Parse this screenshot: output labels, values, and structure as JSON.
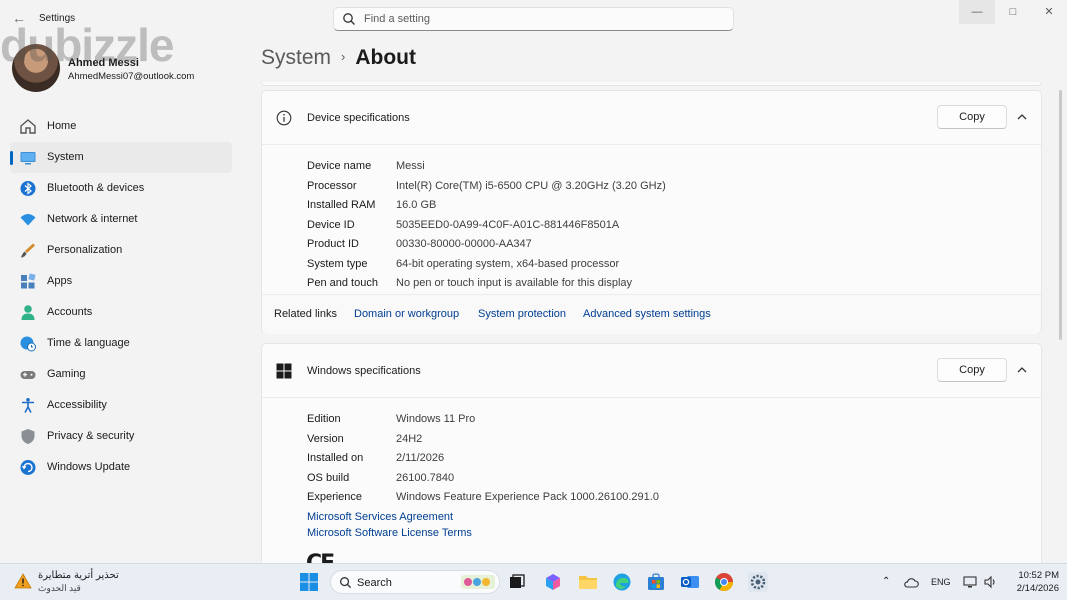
{
  "app": {
    "title": "Settings",
    "search_placeholder": "Find a setting",
    "watermark": "dubizzle"
  },
  "profile": {
    "name": "Ahmed Messi",
    "email": "AhmedMessi07@outlook.com"
  },
  "sidebar": {
    "items": [
      {
        "label": "Home",
        "icon": "home-icon"
      },
      {
        "label": "System",
        "icon": "system-icon",
        "active": true
      },
      {
        "label": "Bluetooth & devices",
        "icon": "bluetooth-icon"
      },
      {
        "label": "Network & internet",
        "icon": "network-icon"
      },
      {
        "label": "Personalization",
        "icon": "brush-icon"
      },
      {
        "label": "Apps",
        "icon": "apps-icon"
      },
      {
        "label": "Accounts",
        "icon": "accounts-icon"
      },
      {
        "label": "Time & language",
        "icon": "globe-clock-icon"
      },
      {
        "label": "Gaming",
        "icon": "gamepad-icon"
      },
      {
        "label": "Accessibility",
        "icon": "accessibility-icon"
      },
      {
        "label": "Privacy & security",
        "icon": "shield-icon"
      },
      {
        "label": "Windows Update",
        "icon": "update-icon"
      }
    ]
  },
  "breadcrumb": {
    "parent": "System",
    "separator": "›",
    "current": "About"
  },
  "device_specs": {
    "title": "Device specifications",
    "copy_label": "Copy",
    "rows": [
      {
        "label": "Device name",
        "value": "Messi"
      },
      {
        "label": "Processor",
        "value": "Intel(R) Core(TM) i5-6500 CPU @ 3.20GHz (3.20 GHz)"
      },
      {
        "label": "Installed RAM",
        "value": "16.0 GB"
      },
      {
        "label": "Device ID",
        "value": "5035EED0-0A99-4C0F-A01C-881446F8501A"
      },
      {
        "label": "Product ID",
        "value": "00330-80000-00000-AA347"
      },
      {
        "label": "System type",
        "value": "64-bit operating system, x64-based processor"
      },
      {
        "label": "Pen and touch",
        "value": "No pen or touch input is available for this display"
      }
    ]
  },
  "related_links": {
    "title": "Related links",
    "links": [
      "Domain or workgroup",
      "System protection",
      "Advanced system settings"
    ]
  },
  "windows_specs": {
    "title": "Windows specifications",
    "copy_label": "Copy",
    "rows": [
      {
        "label": "Edition",
        "value": "Windows 11 Pro"
      },
      {
        "label": "Version",
        "value": "24H2"
      },
      {
        "label": "Installed on",
        "value": "2/11/2026"
      },
      {
        "label": "OS build",
        "value": "26100.7840"
      },
      {
        "label": "Experience",
        "value": "Windows Feature Experience Pack 1000.26100.291.0"
      }
    ],
    "links": [
      "Microsoft Services Agreement",
      "Microsoft Software License Terms"
    ],
    "ce_mark": "CE"
  },
  "taskbar": {
    "warning_title": "تحذير أترية متطايرة",
    "warning_subtitle": "قيد الحدوث",
    "search_label": "Search",
    "language": "ENG",
    "time": "10:52 PM",
    "date": "2/14/2026"
  },
  "colors": {
    "accent": "#0067c0",
    "link": "#003e92",
    "background": "#f3f3f3",
    "card": "#fbfbfb"
  }
}
